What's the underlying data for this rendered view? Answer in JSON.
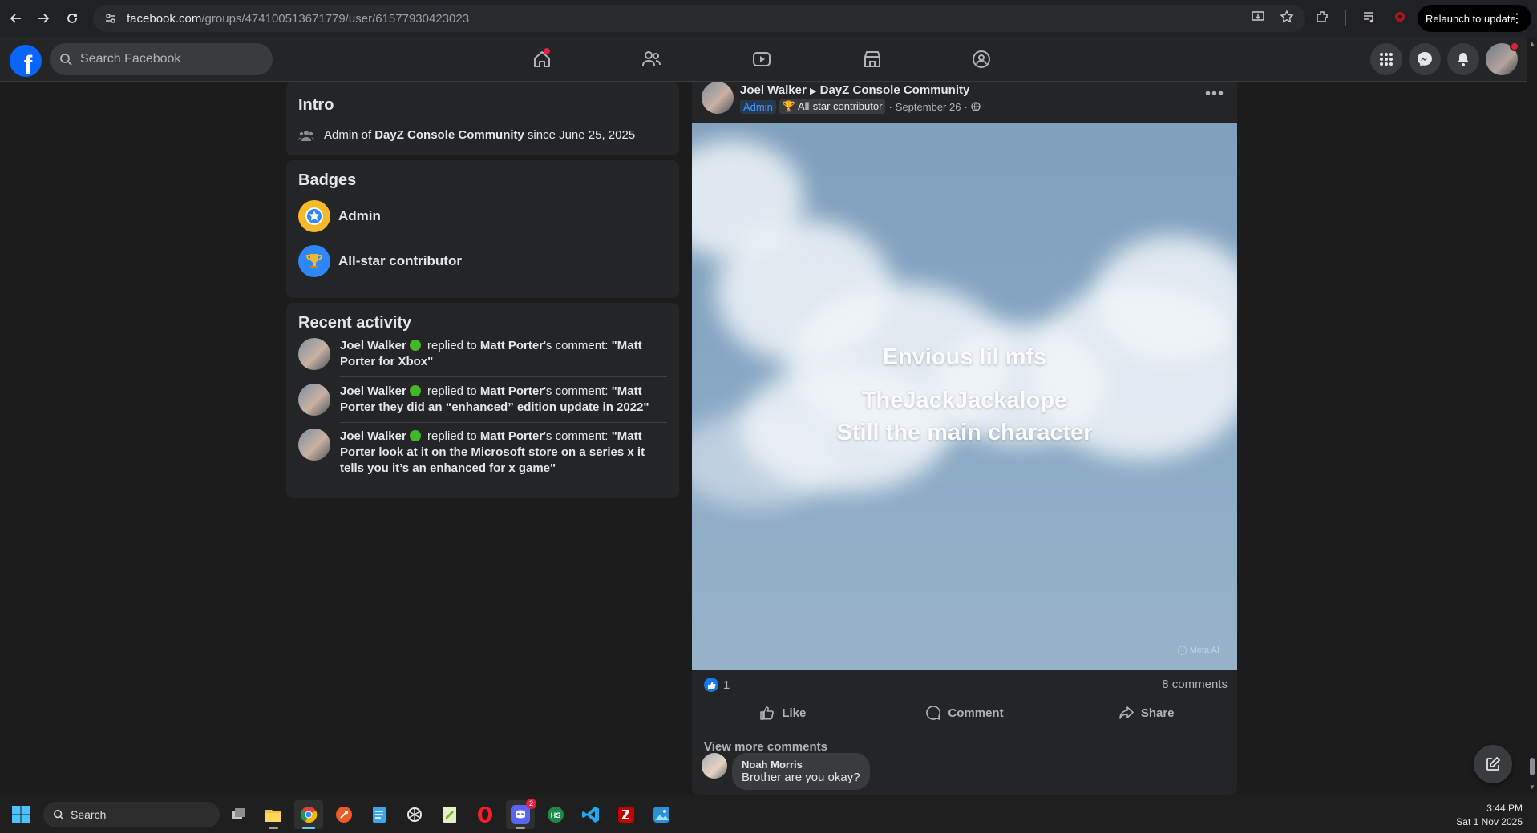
{
  "browser": {
    "url_host": "facebook.com",
    "url_path": "/groups/474100513671779/user/61577930423023",
    "relaunch_label": "Relaunch to update"
  },
  "facebook": {
    "search_placeholder": "Search Facebook"
  },
  "intro": {
    "title": "Intro",
    "prefix": "Admin of ",
    "group": "DayZ Console Community",
    "suffix": " since June 25, 2025"
  },
  "badges": {
    "title": "Badges",
    "items": [
      {
        "label": "Admin",
        "color": "#f7b928"
      },
      {
        "label": "All-star contributor",
        "color": "#2d88ff"
      }
    ]
  },
  "activity": {
    "title": "Recent activity",
    "items": [
      {
        "actor": "Joel Walker",
        "verb": " replied to ",
        "target": "Matt Porter",
        "rest": "'s comment: ",
        "quote": "\"Matt Porter for Xbox\""
      },
      {
        "actor": "Joel Walker",
        "verb": " replied to ",
        "target": "Matt Porter",
        "rest": "'s comment: ",
        "quote": "\"Matt Porter they did an “enhanced” edition update in 2022\""
      },
      {
        "actor": "Joel Walker",
        "verb": " replied to ",
        "target": "Matt Porter",
        "rest": "'s comment: ",
        "quote": "\"Matt Porter look at it on the Microsoft store on a series x it tells you it’s an enhanced for x game\""
      }
    ]
  },
  "post": {
    "author": "Joel Walker",
    "group": "DayZ Console Community",
    "admin_chip": "Admin",
    "star_chip": "All-star contributor",
    "date": "September 26",
    "caption_line1": "Envious lil mfs",
    "caption_line2": "TheJackJackalope",
    "caption_line3": "Still the main character",
    "watermark": "Meta AI",
    "reaction_count": "1",
    "comments_count": "8 comments",
    "like_label": "Like",
    "comment_label": "Comment",
    "share_label": "Share",
    "view_more": "View more comments",
    "comment_author": "Noah Morris",
    "comment_text": "Brother are you okay?"
  },
  "taskbar": {
    "search_placeholder": "Search",
    "discord_badge": "2",
    "time": "3:44 PM",
    "date": "Sat 1 Nov 2025"
  },
  "colors": {
    "fb_blue": "#0866ff",
    "notification_red": "#e41e3f",
    "card_bg": "#242526",
    "page_bg": "#1c1c1d"
  }
}
